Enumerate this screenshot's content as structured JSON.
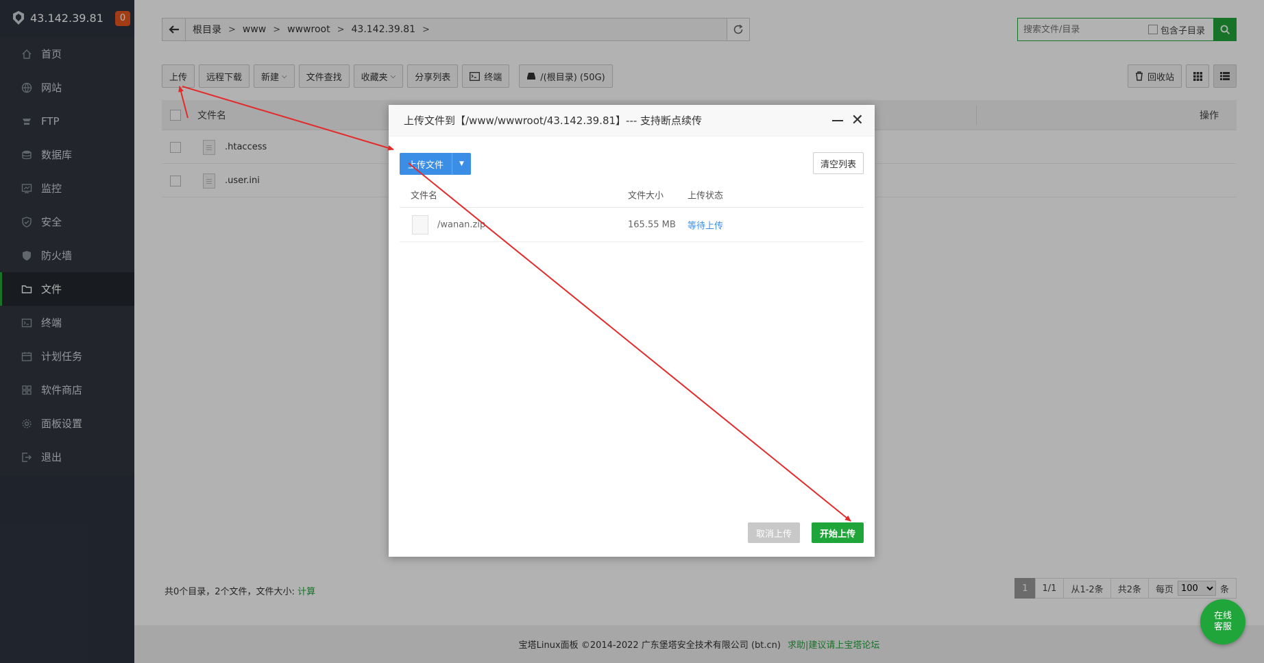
{
  "sidebar": {
    "server_ip": "43.142.39.81",
    "badge_count": "0",
    "items": [
      {
        "label": "首页",
        "icon": "home-icon"
      },
      {
        "label": "网站",
        "icon": "globe-icon"
      },
      {
        "label": "FTP",
        "icon": "ftp-icon"
      },
      {
        "label": "数据库",
        "icon": "database-icon"
      },
      {
        "label": "监控",
        "icon": "monitor-icon"
      },
      {
        "label": "安全",
        "icon": "shield-icon"
      },
      {
        "label": "防火墙",
        "icon": "firewall-icon"
      },
      {
        "label": "文件",
        "icon": "folder-icon",
        "active": true
      },
      {
        "label": "终端",
        "icon": "terminal-icon"
      },
      {
        "label": "计划任务",
        "icon": "calendar-icon"
      },
      {
        "label": "软件商店",
        "icon": "grid-icon"
      },
      {
        "label": "面板设置",
        "icon": "gear-icon"
      },
      {
        "label": "退出",
        "icon": "logout-icon"
      }
    ]
  },
  "pathbar": {
    "crumbs": [
      "根目录",
      "www",
      "wwwroot",
      "43.142.39.81"
    ]
  },
  "search": {
    "placeholder": "搜索文件/目录",
    "sub_label": "包含子目录"
  },
  "toolbar": {
    "upload": "上传",
    "remote_download": "远程下载",
    "new": "新建",
    "find": "文件查找",
    "favorites": "收藏夹",
    "share_list": "分享列表",
    "terminal": "终端",
    "disk": "/(根目录) (50G)",
    "recycle": "回收站"
  },
  "table": {
    "col_name": "文件名",
    "col_ops": "操作",
    "rows": [
      {
        "name": ".htaccess"
      },
      {
        "name": ".user.ini"
      }
    ]
  },
  "summary": {
    "text": "共0个目录，2个文件，文件大小: ",
    "calc": "计算"
  },
  "pager": {
    "current": "1",
    "pages": "1/1",
    "range": "从1-2条",
    "total": "共2条",
    "per_page_label": "每页",
    "per_page": "100",
    "unit": "条"
  },
  "footer": {
    "copyright": "宝塔Linux面板 ©2014-2022 广东堡塔安全技术有限公司 (bt.cn)",
    "link": "求助|建议请上宝塔论坛"
  },
  "dialog": {
    "title": "上传文件到【/www/wwwroot/43.142.39.81】--- 支持断点续传",
    "upload_btn": "上传文件",
    "clear_btn": "清空列表",
    "col_name": "文件名",
    "col_size": "文件大小",
    "col_status": "上传状态",
    "files": [
      {
        "name": "/wanan.zip",
        "size": "165.55 MB",
        "status": "等待上传"
      }
    ],
    "cancel_btn": "取消上传",
    "start_btn": "开始上传"
  },
  "service": {
    "line1": "在线",
    "line2": "客服"
  },
  "colors": {
    "accent": "#20a53a",
    "blue": "#3a8ee6",
    "arrow": "#e32b2b"
  }
}
